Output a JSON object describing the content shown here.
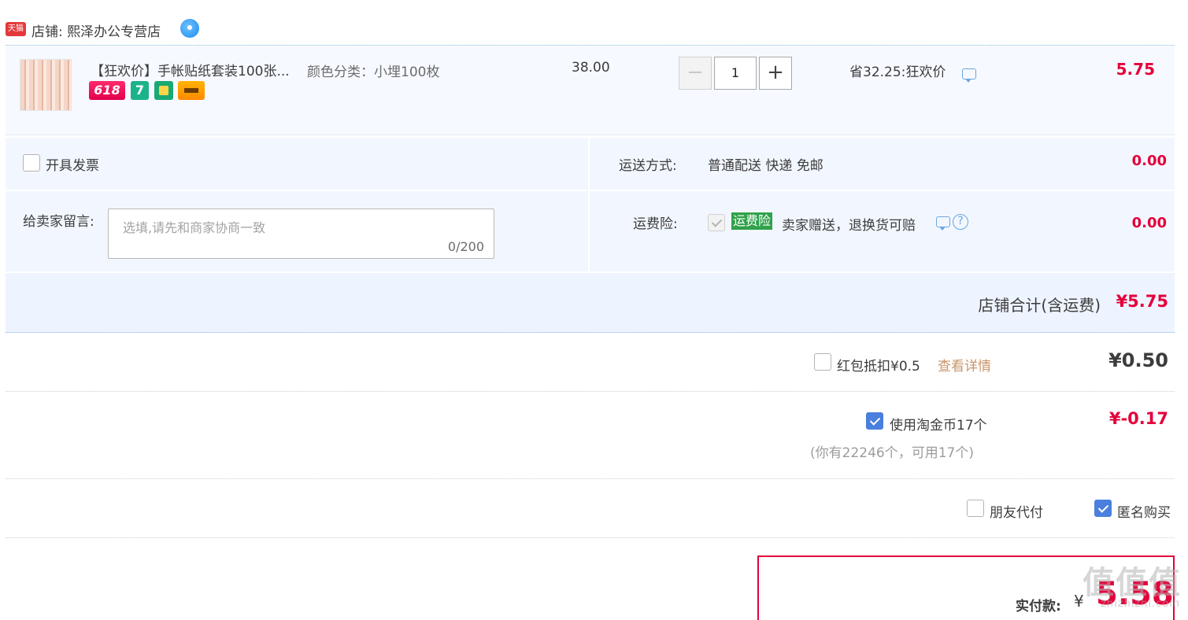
{
  "shop": {
    "platform_badge": "天猫",
    "label": "店铺:",
    "name": "熙泽办公专营店"
  },
  "item": {
    "title": "【狂欢价】手帐贴纸套装100张...",
    "sku": "颜色分类：小埋100枚",
    "badge_618": "618",
    "badge_7": "7",
    "price": "38.00",
    "quantity": "1",
    "qty_minus": "−",
    "qty_plus": "+",
    "promo": "省32.25:狂欢价",
    "subtotal": "5.75"
  },
  "invoice": {
    "label": "开具发票",
    "checked": false
  },
  "shipping": {
    "label": "运送方式:",
    "value": "普通配送 快递 免邮",
    "amount": "0.00"
  },
  "message": {
    "label": "给卖家留言:",
    "placeholder": "选填,请先和商家协商一致",
    "counter": "0/200"
  },
  "insurance": {
    "label": "运费险:",
    "tag": "运费险",
    "desc": "卖家赠送，退换货可赔",
    "help": "?",
    "amount": "0.00"
  },
  "shop_total": {
    "label": "店铺合计(含运费)",
    "amount": "¥5.75"
  },
  "red_packet": {
    "label": "红包抵扣¥0.5",
    "link": "查看详情",
    "amount": "¥0.50",
    "checked": false
  },
  "taojinbi": {
    "label": "使用淘金币17个",
    "note": "(你有22246个，可用17个)",
    "amount": "¥-0.17",
    "checked": true
  },
  "friend_pay": {
    "label": "朋友代付",
    "checked": false
  },
  "anonymous": {
    "label": "匿名购买",
    "checked": true
  },
  "payment": {
    "label": "实付款:",
    "currency": "¥",
    "amount": "5.58"
  },
  "watermark": {
    "main": "值值值",
    "sub": "zhizhizhi.com"
  },
  "colors": {
    "accent_red": "#e4003a",
    "checkbox_blue": "#4a7fde",
    "panel_blue": "#f2f7ff",
    "tag_green": "#2fa24a"
  }
}
